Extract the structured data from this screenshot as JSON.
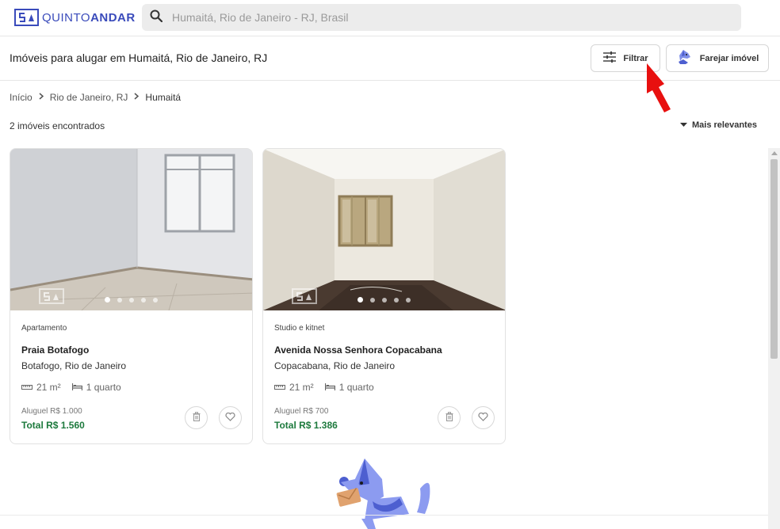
{
  "header": {
    "brand_light": "QUINTO",
    "brand_bold": "ANDAR",
    "search_placeholder": "Humaitá, Rio de Janeiro - RJ, Brasil"
  },
  "subheader": {
    "title": "Imóveis para alugar em Humaitá, Rio de Janeiro, RJ",
    "filter_label": "Filtrar",
    "sniff_label": "Farejar imóvel"
  },
  "breadcrumb": [
    "Início",
    "Rio de Janeiro, RJ",
    "Humaitá"
  ],
  "results": {
    "count_text": "2 imóveis encontrados",
    "sort_label": "Mais relevantes"
  },
  "listings": [
    {
      "type": "Apartamento",
      "street": "Praia Botafogo",
      "neighborhood": "Botafogo, Rio de Janeiro",
      "area": "21 m²",
      "rooms": "1 quarto",
      "rent": "Aluguel R$ 1.000",
      "total": "Total R$ 1.560",
      "photo_count": 5,
      "active_photo": 0
    },
    {
      "type": "Studio e kitnet",
      "street": "Avenida Nossa Senhora Copacabana",
      "neighborhood": "Copacabana, Rio de Janeiro",
      "area": "21 m²",
      "rooms": "1 quarto",
      "rent": "Aluguel R$ 700",
      "total": "Total R$ 1.386",
      "photo_count": 5,
      "active_photo": 0
    }
  ],
  "colors": {
    "brand": "#3a4bbb",
    "total_price": "#1d7a3d",
    "annotation_arrow": "#e8100f"
  }
}
